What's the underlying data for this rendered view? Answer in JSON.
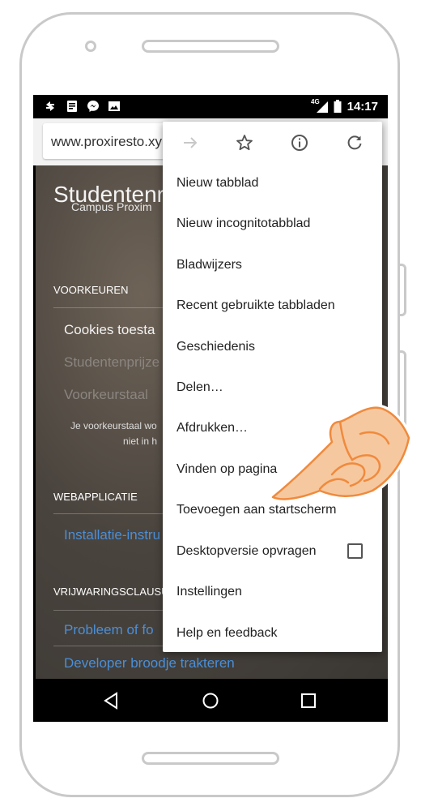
{
  "status_bar": {
    "time": "14:17",
    "network_label": "4G",
    "icons": [
      "sync-icon",
      "note-icon",
      "messenger-icon",
      "image-icon",
      "signal-icon",
      "battery-icon"
    ]
  },
  "browser": {
    "url": "www.proxiresto.xy"
  },
  "page": {
    "title": "Studentenr",
    "subtitle": "Campus Proxim",
    "sections": {
      "preferences": "VOORKEUREN",
      "webapp": "WEBAPPLICATIE",
      "disclaimer": "VRIJWARINGSCLAUSU"
    },
    "options": {
      "cookies": "Cookies toesta",
      "student_prices": "Studentenprijze",
      "preferred_language": "Voorkeurstaal"
    },
    "notes": {
      "line1": "Je voorkeurstaal wo",
      "line2": "niet in h"
    },
    "links": {
      "install": "Installatie-instru",
      "problem": "Probleem of fo",
      "developer": "Developer broodje trakteren"
    }
  },
  "menu": {
    "toolbar_icons": [
      "forward-icon",
      "star-icon",
      "info-icon",
      "reload-icon"
    ],
    "items": [
      "Nieuw tabblad",
      "Nieuw incognitotabblad",
      "Bladwijzers",
      "Recent gebruikte tabbladen",
      "Geschiedenis",
      "Delen…",
      "Afdrukken…",
      "Vinden op pagina",
      "Toevoegen aan startscherm",
      "Desktopversie opvragen",
      "Instellingen",
      "Help en feedback"
    ],
    "desktop_checkbox_checked": false
  },
  "colors": {
    "link": "#4a8fd8",
    "hand_fill": "#f6c8a0",
    "hand_stroke": "#f08a3c"
  }
}
